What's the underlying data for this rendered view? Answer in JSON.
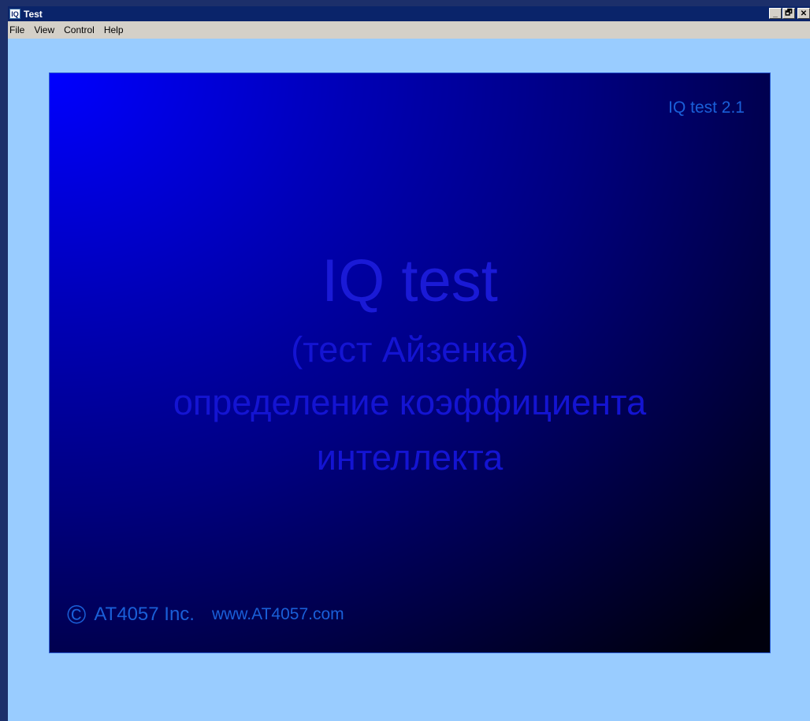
{
  "window": {
    "icon_text": "IQ",
    "title": "Test",
    "controls": [
      "_",
      "🗗",
      "✕"
    ]
  },
  "menu": [
    {
      "label": "File"
    },
    {
      "label": "View"
    },
    {
      "label": "Control"
    },
    {
      "label": "Help"
    }
  ],
  "splash": {
    "version": "IQ test 2.1",
    "title": "IQ test",
    "subtitle": "(тест Айзенка)",
    "description_line1": "определение коэффициента",
    "description_line2": "интеллекта",
    "copyright_symbol": "©",
    "company": "AT4057 Inc.",
    "website": "www.AT4057.com"
  },
  "colors": {
    "desktop": "#1c2f6a",
    "window_bg": "#99ccff",
    "titlebar": "#0a246a",
    "splash_accent": "#0000ff"
  }
}
